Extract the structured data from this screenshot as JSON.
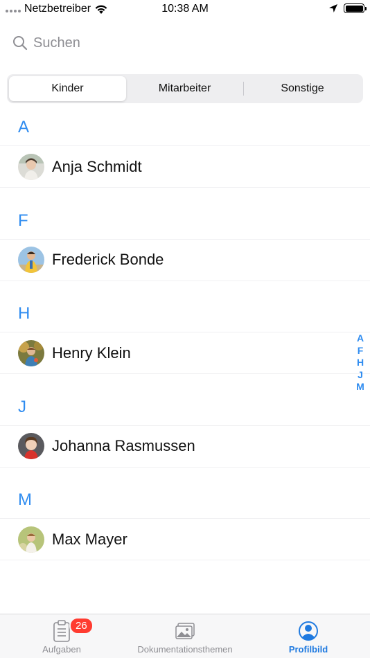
{
  "status_bar": {
    "carrier": "Netzbetreiber",
    "time": "10:38 AM"
  },
  "search": {
    "placeholder": "Suchen",
    "value": ""
  },
  "segments": [
    {
      "label": "Kinder",
      "active": true
    },
    {
      "label": "Mitarbeiter",
      "active": false
    },
    {
      "label": "Sonstige",
      "active": false
    }
  ],
  "sections": [
    {
      "letter": "A",
      "name": "Anja Schmidt"
    },
    {
      "letter": "F",
      "name": "Frederick Bonde"
    },
    {
      "letter": "H",
      "name": "Henry Klein"
    },
    {
      "letter": "J",
      "name": "Johanna Rasmussen"
    },
    {
      "letter": "M",
      "name": "Max Mayer"
    }
  ],
  "index_letters": [
    "A",
    "F",
    "H",
    "J",
    "M"
  ],
  "tabbar": {
    "tasks_label": "Aufgaben",
    "tasks_badge": "26",
    "docs_label": "Dokumentationsthemen",
    "profile_label": "Profilbild"
  },
  "colors": {
    "accent": "#2f8cf0",
    "badge": "#ff3b30",
    "tab_active": "#1f7ae0"
  }
}
